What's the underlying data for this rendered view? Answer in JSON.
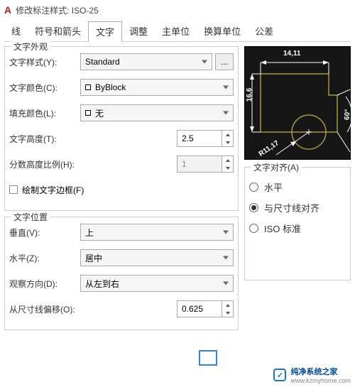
{
  "title": "修改标注样式: ISO-25",
  "tabs": {
    "t0": "线",
    "t1": "符号和箭头",
    "t2": "文字",
    "t3": "调整",
    "t4": "主单位",
    "t5": "换算单位",
    "t6": "公差"
  },
  "appearance": {
    "legend": "文字外观",
    "style_label": "文字样式(Y):",
    "style_value": "Standard",
    "color_label": "文字颜色(C):",
    "color_value": "ByBlock",
    "fill_label": "填充颜色(L):",
    "fill_value": "无",
    "height_label": "文字高度(T):",
    "height_value": "2.5",
    "frac_label": "分数高度比例(H):",
    "frac_value": "1",
    "frame_label": "绘制文字边框(F)",
    "more": "..."
  },
  "placement": {
    "legend": "文字位置",
    "vert_label": "垂直(V):",
    "vert_value": "上",
    "horiz_label": "水平(Z):",
    "horiz_value": "居中",
    "dir_label": "观察方向(D):",
    "dir_value": "从左到右",
    "offset_label": "从尺寸线偏移(O):",
    "offset_value": "0.625"
  },
  "align": {
    "legend": "文字对齐(A)",
    "r1": "水平",
    "r2": "与尺寸线对齐",
    "r3": "ISO 标准"
  },
  "preview": {
    "d1": "14,11",
    "d2": "16,6",
    "d3": "R11,17",
    "d4": "60°"
  },
  "watermark": {
    "name": "纯净系统之家",
    "url": "www.kzmyhome.com"
  }
}
